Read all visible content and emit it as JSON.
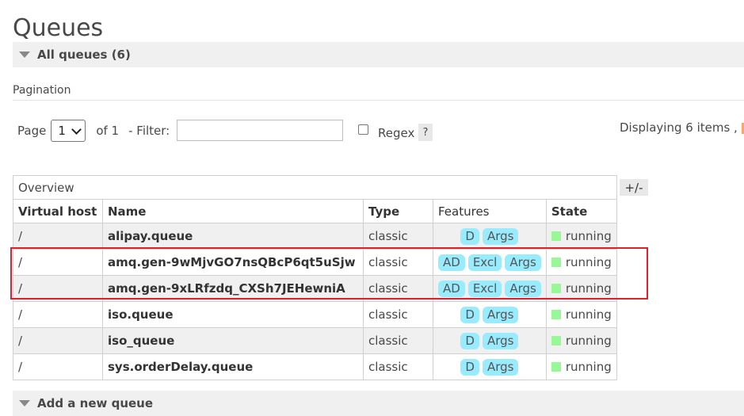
{
  "page": {
    "title": "Queues"
  },
  "all_queues": {
    "label": "All queues (6)"
  },
  "pagination": {
    "heading": "Pagination",
    "page_label": "Page",
    "page_value": "1",
    "of_label": "of 1",
    "filter_label": "- Filter:",
    "filter_value": "",
    "regex_label": "Regex",
    "help_label": "?",
    "displaying": "Displaying 6 items ,"
  },
  "table": {
    "toggle_label": "+/-",
    "groups": {
      "overview": "Overview",
      "features": "Features"
    },
    "headers": {
      "vhost": "Virtual host",
      "name": "Name",
      "type": "Type",
      "state": "State"
    },
    "rows": [
      {
        "vhost": "/",
        "name": "alipay.queue",
        "type": "classic",
        "features": [
          "D",
          "Args"
        ],
        "state": "running"
      },
      {
        "vhost": "/",
        "name": "amq.gen-9wMjvGO7nsQBcP6qt5uSjw",
        "type": "classic",
        "features": [
          "AD",
          "Excl",
          "Args"
        ],
        "state": "running"
      },
      {
        "vhost": "/",
        "name": "amq.gen-9xLRfzdq_CXSh7JEHewniA",
        "type": "classic",
        "features": [
          "AD",
          "Excl",
          "Args"
        ],
        "state": "running"
      },
      {
        "vhost": "/",
        "name": "iso.queue",
        "type": "classic",
        "features": [
          "D",
          "Args"
        ],
        "state": "running"
      },
      {
        "vhost": "/",
        "name": "iso_queue",
        "type": "classic",
        "features": [
          "D",
          "Args"
        ],
        "state": "running"
      },
      {
        "vhost": "/",
        "name": "sys.orderDelay.queue",
        "type": "classic",
        "features": [
          "D",
          "Args"
        ],
        "state": "running"
      }
    ]
  },
  "add_queue": {
    "label": "Add a new queue"
  },
  "colors": {
    "tag": "#99ebff",
    "running": "#98f898",
    "highlight": "#e02030"
  }
}
